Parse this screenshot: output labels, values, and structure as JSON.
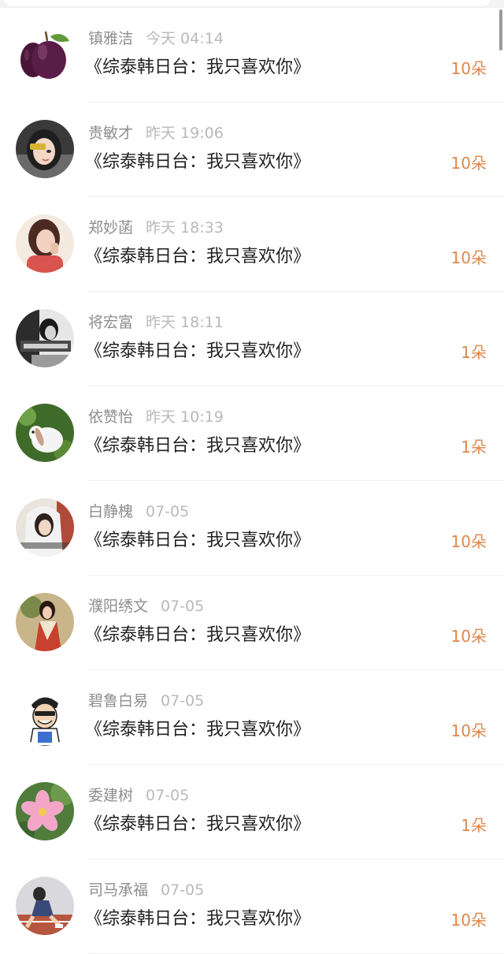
{
  "colors": {
    "accent": "#e0874a",
    "name": "#8d8d8d",
    "time": "#b9b9b9",
    "title": "#222222"
  },
  "records": [
    {
      "name": "镇雅洁",
      "time": "今天 04:14",
      "title": "《综泰韩日台：我只喜欢你》",
      "count": "10朵",
      "avatar_icon": "plum-avatar-icon"
    },
    {
      "name": "贵敏才",
      "time": "昨天 19:06",
      "title": "《综泰韩日台：我只喜欢你》",
      "count": "10朵",
      "avatar_icon": "girl-portrait-avatar-icon"
    },
    {
      "name": "郑妙菡",
      "time": "昨天 18:33",
      "title": "《综泰韩日台：我只喜欢你》",
      "count": "10朵",
      "avatar_icon": "girl-red-avatar-icon"
    },
    {
      "name": "将宏富",
      "time": "昨天 18:11",
      "title": "《综泰韩日台：我只喜欢你》",
      "count": "1朵",
      "avatar_icon": "monochrome-photo-avatar-icon"
    },
    {
      "name": "依赞怡",
      "time": "昨天 10:19",
      "title": "《综泰韩日台：我只喜欢你》",
      "count": "1朵",
      "avatar_icon": "rabbit-avatar-icon"
    },
    {
      "name": "白静槐",
      "time": "07-05",
      "title": "《综泰韩日台：我只喜欢你》",
      "count": "10朵",
      "avatar_icon": "girl-hoodie-avatar-icon"
    },
    {
      "name": "濮阳绣文",
      "time": "07-05",
      "title": "《综泰韩日台：我只喜欢你》",
      "count": "10朵",
      "avatar_icon": "costume-avatar-icon"
    },
    {
      "name": "碧鲁白易",
      "time": "07-05",
      "title": "《综泰韩日台：我只喜欢你》",
      "count": "10朵",
      "avatar_icon": "cartoon-man-avatar-icon"
    },
    {
      "name": "委建树",
      "time": "07-05",
      "title": "《综泰韩日台：我只喜欢你》",
      "count": "1朵",
      "avatar_icon": "pink-flower-avatar-icon"
    },
    {
      "name": "司马承福",
      "time": "07-05",
      "title": "《综泰韩日台：我只喜欢你》",
      "count": "10朵",
      "avatar_icon": "running-track-avatar-icon"
    }
  ]
}
